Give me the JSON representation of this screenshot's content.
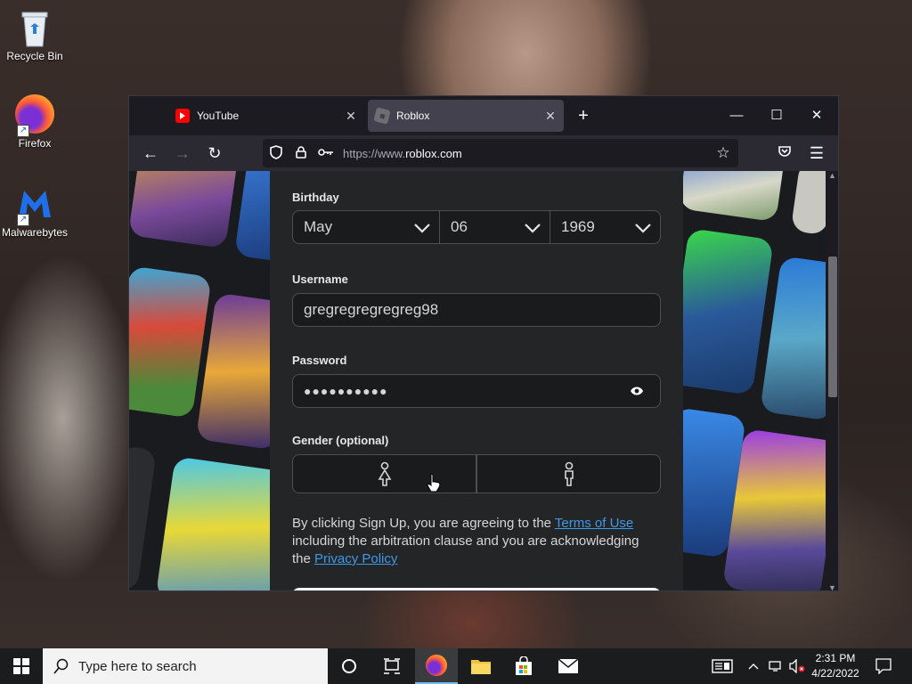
{
  "desktop": {
    "icons": [
      {
        "label": "Recycle Bin"
      },
      {
        "label": "Firefox"
      },
      {
        "label": "Malwarebytes"
      }
    ]
  },
  "browser": {
    "tabs": [
      {
        "title": "YouTube",
        "icon": "youtube-icon",
        "active": false
      },
      {
        "title": "Roblox",
        "icon": "roblox-icon",
        "active": true
      }
    ],
    "url": {
      "prefix": "https://www.",
      "domain": "roblox.com"
    }
  },
  "form": {
    "birthday_label": "Birthday",
    "birthday": {
      "month": "May",
      "day": "06",
      "year": "1969"
    },
    "username_label": "Username",
    "username_value": "gregregregregreg98",
    "password_label": "Password",
    "password_masked": "●●●●●●●●●●",
    "gender_label": "Gender (optional)",
    "terms": {
      "part1": "By clicking Sign Up, you are agreeing to the ",
      "link1": "Terms of Use",
      "part2": " including the arbitration clause and you are acknowledging the ",
      "link2": "Privacy Policy"
    }
  },
  "taskbar": {
    "search_placeholder": "Type here to search",
    "time": "2:31 PM",
    "date": "4/22/2022"
  },
  "colors": {
    "link": "#3f99e8",
    "youtube": "#ff0000",
    "panel": "#232527"
  }
}
